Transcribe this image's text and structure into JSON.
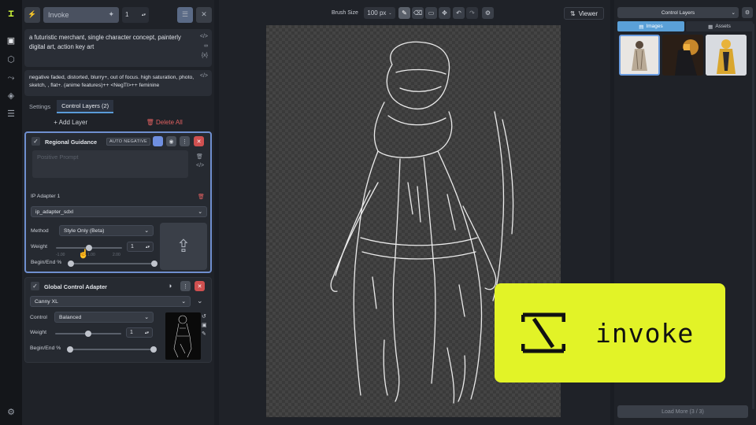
{
  "topbar": {
    "invoke_label": "Invoke",
    "iterations": "1"
  },
  "prompts": {
    "positive": "a futuristic merchant, single character concept, painterly digital art, action key art",
    "negative": "negative faded, distorted, blurry+, out of focus. high saturation, photo, sketch, , flat+. (anime features)++ <NegTI>++ feminine"
  },
  "tabs": [
    {
      "label": "Settings"
    },
    {
      "label": "Control Layers (2)"
    }
  ],
  "layer_actions": {
    "add": "Add Layer",
    "delete": "Delete All"
  },
  "regional": {
    "title": "Regional Guidance",
    "badge": "AUTO NEGATIVE",
    "prompt_placeholder": "Positive Prompt",
    "ip_adapter_title": "IP Adapter 1",
    "model": "ip_adapter_sdxl",
    "method_label": "Method",
    "method_value": "Style Only (Beta)",
    "weight_label": "Weight",
    "weight_value": "1",
    "weight_fraction": 0.5,
    "tick_min": "-1.00",
    "tick_mid": "1.00",
    "tick_max": "2.00",
    "begin_end_label": "Begin/End %"
  },
  "global": {
    "title": "Global Control Adapter",
    "model": "Canny XL",
    "control_label": "Control",
    "control_value": "Balanced",
    "weight_label": "Weight",
    "weight_value": "1",
    "begin_end_label": "Begin/End %"
  },
  "toolbar": {
    "brush_label": "Brush Size",
    "brush_value": "100 px",
    "viewer": "Viewer"
  },
  "right": {
    "panel_select": "Control Layers",
    "tab_images": "Images",
    "tab_assets": "Assets",
    "load_more": "Load More (3 / 3)"
  },
  "brand": {
    "word": "invoke"
  }
}
